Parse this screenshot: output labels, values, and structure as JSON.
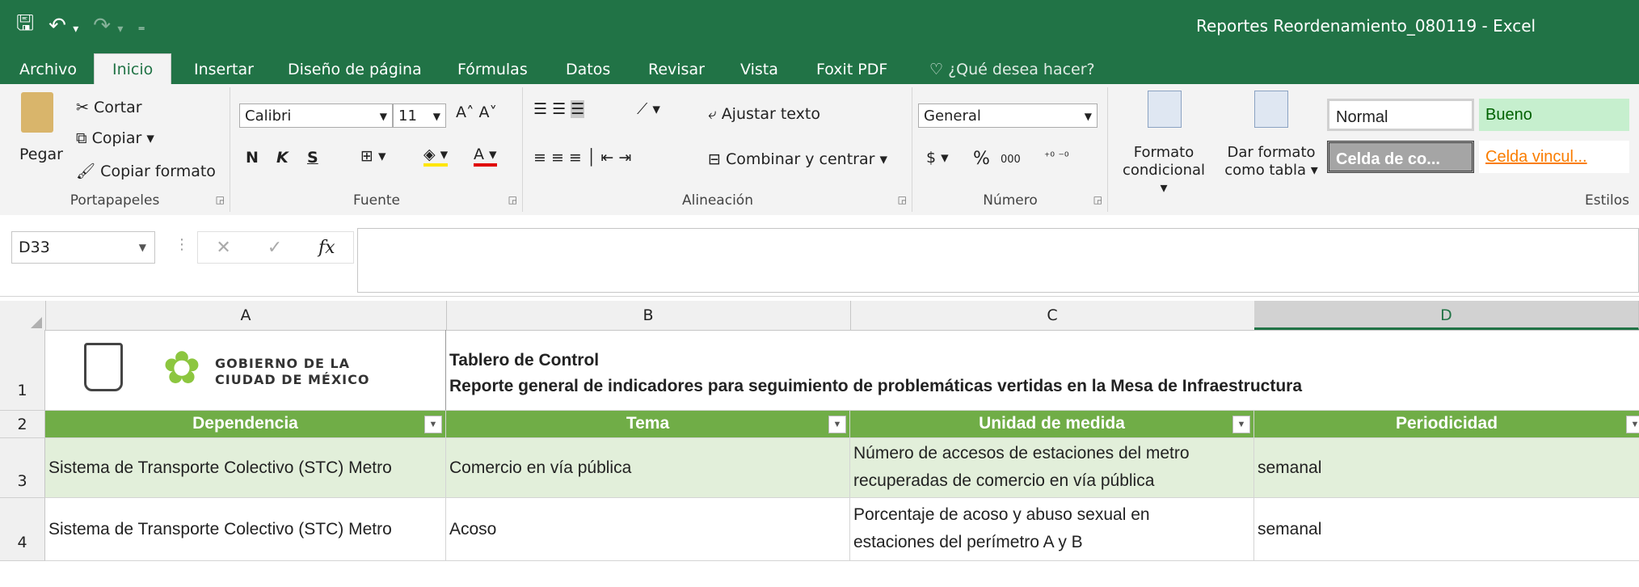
{
  "window": {
    "title": "Reportes Reordenamiento_080119 - Excel"
  },
  "qat": {
    "save_icon": "save-icon",
    "undo_icon": "undo-icon",
    "redo_icon": "redo-icon",
    "customize_icon": "customize-icon"
  },
  "tabs": [
    "Archivo",
    "Inicio",
    "Insertar",
    "Diseño de página",
    "Fórmulas",
    "Datos",
    "Revisar",
    "Vista",
    "Foxit PDF"
  ],
  "tell_me": "¿Qué desea hacer?",
  "ribbon": {
    "clipboard": {
      "paste": "Pegar",
      "cut": "Cortar",
      "copy": "Copiar",
      "format_painter": "Copiar formato",
      "label": "Portapapeles"
    },
    "font": {
      "name": "Calibri",
      "size": "11",
      "bold": "N",
      "italic": "K",
      "underline": "S",
      "label": "Fuente"
    },
    "alignment": {
      "wrap": "Ajustar texto",
      "merge": "Combinar y centrar",
      "label": "Alineación"
    },
    "number": {
      "format": "General",
      "currency": "$",
      "percent": "%",
      "thousands": "000",
      "label": "Número"
    },
    "styles": {
      "cond_format_1": "Formato",
      "cond_format_2": "condicional",
      "as_table_1": "Dar formato",
      "as_table_2": "como tabla",
      "normal": "Normal",
      "good": "Bueno",
      "check_cell": "Celda de co...",
      "linked_cell": "Celda vincul...",
      "label": "Estilos"
    }
  },
  "formula_bar": {
    "name_box": "D33",
    "content": ""
  },
  "columns": [
    "A",
    "B",
    "C",
    "D"
  ],
  "rows": {
    "r1": {
      "num": "1",
      "logo_line1": "GOBIERNO DE LA",
      "logo_line2": "CIUDAD DE MÉXICO",
      "title1": "Tablero de Control",
      "title2": "Reporte general de indicadores para seguimiento de problemáticas vertidas en la Mesa de Infraestructura"
    },
    "r2": {
      "num": "2",
      "headers": [
        "Dependencia",
        "Tema",
        "Unidad de medida",
        "Periodicidad"
      ]
    },
    "r3": {
      "num": "3",
      "a": "Sistema de Transporte Colectivo (STC) Metro",
      "b": "Comercio en vía pública",
      "c1": "Número de accesos de estaciones del metro",
      "c2": "recuperadas de comercio en vía pública",
      "d": "semanal"
    },
    "r4": {
      "num": "4",
      "a": "Sistema de Transporte Colectivo (STC) Metro",
      "b": "Acoso",
      "c1": "Porcentaje de acoso y abuso sexual en",
      "c2": "estaciones del perímetro A y B",
      "d": "semanal"
    }
  },
  "colors": {
    "excel_green": "#217346",
    "header_green": "#70ad47",
    "stripe": "#e2efda"
  }
}
